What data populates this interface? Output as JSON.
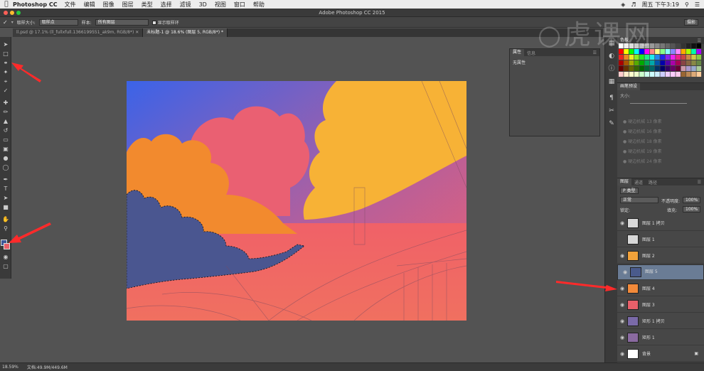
{
  "menubar": {
    "apple_icon": "apple-icon",
    "app": "Photoshop CC",
    "items": [
      "文件",
      "编辑",
      "图像",
      "图层",
      "类型",
      "选择",
      "滤镜",
      "3D",
      "视图",
      "窗口",
      "帮助"
    ],
    "clock": "周五 下午3:19"
  },
  "window": {
    "title": "Adobe Photoshop CC 2015"
  },
  "options": {
    "sample_size_label": "取样大小:",
    "sample_size_value": "取样点",
    "sample_label": "样本:",
    "sample_value": "所有图层",
    "show_ring_label": "显示取样环",
    "workspace": "摄影"
  },
  "tabs": [
    {
      "label": "ll.psd @ 17.1% (ll_fullxfull.1366199551_ak9m, RGB/8*)"
    },
    {
      "label": "未标题-1 @ 18.6% (图层 5, RGB/8*) *"
    }
  ],
  "properties_panel": {
    "tabs": [
      "属性",
      "信息"
    ],
    "content": "无属性"
  },
  "swatches_panel": {
    "tabs": [
      "色板"
    ]
  },
  "brush_panel": {
    "tabs": [
      "画笔预设"
    ],
    "size_label": "大小:",
    "items": [
      "硬边机械 13 像素",
      "硬边机械 16 像素",
      "硬边机械 18 像素",
      "硬边机械 19 像素",
      "硬边机械 24 像素"
    ]
  },
  "layers_panel": {
    "tabs": [
      "图层",
      "通道",
      "路径"
    ],
    "filter": "P 类型",
    "blend": "正常",
    "opacity_label": "不透明度:",
    "opacity": "100%",
    "lock_label": "锁定:",
    "fill_label": "填充:",
    "fill": "100%",
    "layers": [
      {
        "name": "图层 1 拷贝",
        "color": "#d8d8d8",
        "visible": true
      },
      {
        "name": "图层 1",
        "color": "#d8d8d8",
        "visible": false
      },
      {
        "name": "图层 2",
        "color": "#f2a23a",
        "visible": true
      },
      {
        "name": "图层 5",
        "color": "#4a5b8c",
        "visible": true,
        "selected": true
      },
      {
        "name": "图层 4",
        "color": "#f28a3a",
        "visible": true
      },
      {
        "name": "图层 3",
        "color": "#e8606a",
        "visible": true
      },
      {
        "name": "矩形 1 拷贝",
        "color": "#7a6aa8",
        "visible": true
      },
      {
        "name": "矩形 1",
        "color": "#8a6aa0",
        "visible": true
      },
      {
        "name": "背景",
        "color": "#ffffff",
        "visible": true,
        "locked": true
      }
    ]
  },
  "status": {
    "zoom": "18.59%",
    "doc": "文档:49.9M/449.6M"
  },
  "watermark": "虎课网",
  "colors": {
    "sky_top": "#3b63e8",
    "orange_cloud": "#f28a2e",
    "yellow_cloud": "#f7b236",
    "pink_cloud": "#ea6072",
    "ground": "#f0646a",
    "blue_cloud": "#4a5690",
    "arrow": "#ff2a2a"
  }
}
